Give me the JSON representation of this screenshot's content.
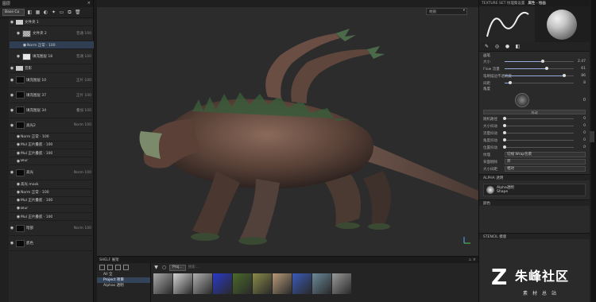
{
  "layers_panel": {
    "title": "图层",
    "blend_mode": "Base Co",
    "layers": [
      {
        "name": "文件夹 1",
        "meta": "",
        "thumb": "folder",
        "indent": 0,
        "tall": false,
        "sel": false
      },
      {
        "name": "文件夹 2",
        "meta": "普通 100",
        "thumb": "check",
        "indent": 1,
        "tall": true,
        "sel": false
      },
      {
        "name": "Norm 正常 · 100",
        "meta": "",
        "thumb": "none",
        "indent": 2,
        "tall": false,
        "sel": true
      },
      {
        "name": "填充图层 18",
        "meta": "普通 100",
        "thumb": "white",
        "indent": 1,
        "tall": true,
        "sel": false
      },
      {
        "name": "音影",
        "meta": "",
        "thumb": "folder",
        "indent": 0,
        "tall": false,
        "sel": false
      },
      {
        "name": "填充图层 10",
        "meta": "正片 100",
        "thumb": "black",
        "indent": 0,
        "tall": true,
        "sel": false
      },
      {
        "name": "填充图层 37",
        "meta": "正片 100",
        "thumb": "black",
        "indent": 0,
        "tall": true,
        "sel": false
      },
      {
        "name": "填充图层 34",
        "meta": "叠加 100",
        "thumb": "black",
        "indent": 0,
        "tall": true,
        "sel": false
      },
      {
        "name": "高光2",
        "meta": "Norm 100",
        "thumb": "black",
        "indent": 0,
        "tall": true,
        "sel": false
      },
      {
        "name": "Norm 正常 · 100",
        "meta": "",
        "thumb": "none",
        "indent": 1,
        "tall": false,
        "sel": false
      },
      {
        "name": "Mul 正片叠底 · 100",
        "meta": "",
        "thumb": "none",
        "indent": 1,
        "tall": false,
        "sel": false
      },
      {
        "name": "Mul 正片叠底 · 100",
        "meta": "",
        "thumb": "none",
        "indent": 1,
        "tall": false,
        "sel": false
      },
      {
        "name": "Blur",
        "meta": "",
        "thumb": "none",
        "indent": 1,
        "tall": false,
        "sel": false
      },
      {
        "name": "高光",
        "meta": "Norm 100",
        "thumb": "black",
        "indent": 0,
        "tall": true,
        "sel": false
      },
      {
        "name": "高光 mask",
        "meta": "",
        "thumb": "none",
        "indent": 1,
        "tall": false,
        "sel": false
      },
      {
        "name": "Norm 正常 · 100",
        "meta": "",
        "thumb": "none",
        "indent": 1,
        "tall": false,
        "sel": false
      },
      {
        "name": "Mul 正片叠底 · 100",
        "meta": "",
        "thumb": "none",
        "indent": 1,
        "tall": false,
        "sel": false
      },
      {
        "name": "Blur",
        "meta": "",
        "thumb": "none",
        "indent": 1,
        "tall": false,
        "sel": false
      },
      {
        "name": "Mul 正片叠底 · 100",
        "meta": "",
        "thumb": "none",
        "indent": 1,
        "tall": false,
        "sel": false
      },
      {
        "name": "暗部",
        "meta": "Norm 100",
        "thumb": "black",
        "indent": 0,
        "tall": true,
        "sel": false
      },
      {
        "name": "底色",
        "meta": "",
        "thumb": "black",
        "indent": 0,
        "tall": true,
        "sel": false
      }
    ]
  },
  "viewport": {
    "material_select": "材质"
  },
  "properties": {
    "tabs": [
      "TEXTURE SET 纹理集设置",
      "属性 - 绘画"
    ],
    "section": "画笔",
    "sliders": [
      {
        "label": "大小",
        "value": "2.47",
        "pct": 0.55
      },
      {
        "label": "Flow 流量",
        "value": "61",
        "pct": 0.61
      },
      {
        "label": "笔刷描边不透明度",
        "value": "86",
        "pct": 0.86
      },
      {
        "label": "间距",
        "value": "8",
        "pct": 0.08
      }
    ],
    "angle_label": "角度",
    "angle_value": "0",
    "full_button": "抖动",
    "jitter_sliders": [
      {
        "label": "随机路径",
        "value": "0",
        "pct": 0.0
      },
      {
        "label": "大小抖动",
        "value": "0",
        "pct": 0.0
      },
      {
        "label": "流量抖动",
        "value": "0",
        "pct": 0.0
      },
      {
        "label": "角度抖动",
        "value": "0",
        "pct": 0.0
      },
      {
        "label": "位置抖动",
        "value": "0",
        "pct": 0.0
      }
    ],
    "dropdowns": [
      {
        "label": "纹理",
        "value": "切线 Wrap包裹"
      },
      {
        "label": "背面剔除",
        "value": "开"
      },
      {
        "label": "大小间距",
        "value": "相对"
      }
    ],
    "alpha_header": "ALPHA 透明",
    "alpha_name": "Alpha透明",
    "alpha_sub": "Shape",
    "section_2": "颜色",
    "stencil_header": "STENCIL 模版"
  },
  "shelf": {
    "title": "SHELF 展架",
    "categories": [
      "All 全",
      "Project 项目",
      "Alphas 透明"
    ],
    "selected_category": 1,
    "filter_chip": "Proj...",
    "search_placeholder": "搜索...",
    "textures": [
      "#a8a8a8",
      "#d4d4d4",
      "#b0b0b0",
      "#2a38c8",
      "#4a6a2a",
      "#8a8a4a",
      "#b89a78",
      "#3a5ab8",
      "#6a8a9a",
      "#9a9a9a"
    ]
  },
  "watermark": {
    "big": "朱峰社区",
    "small": "素材总站"
  }
}
